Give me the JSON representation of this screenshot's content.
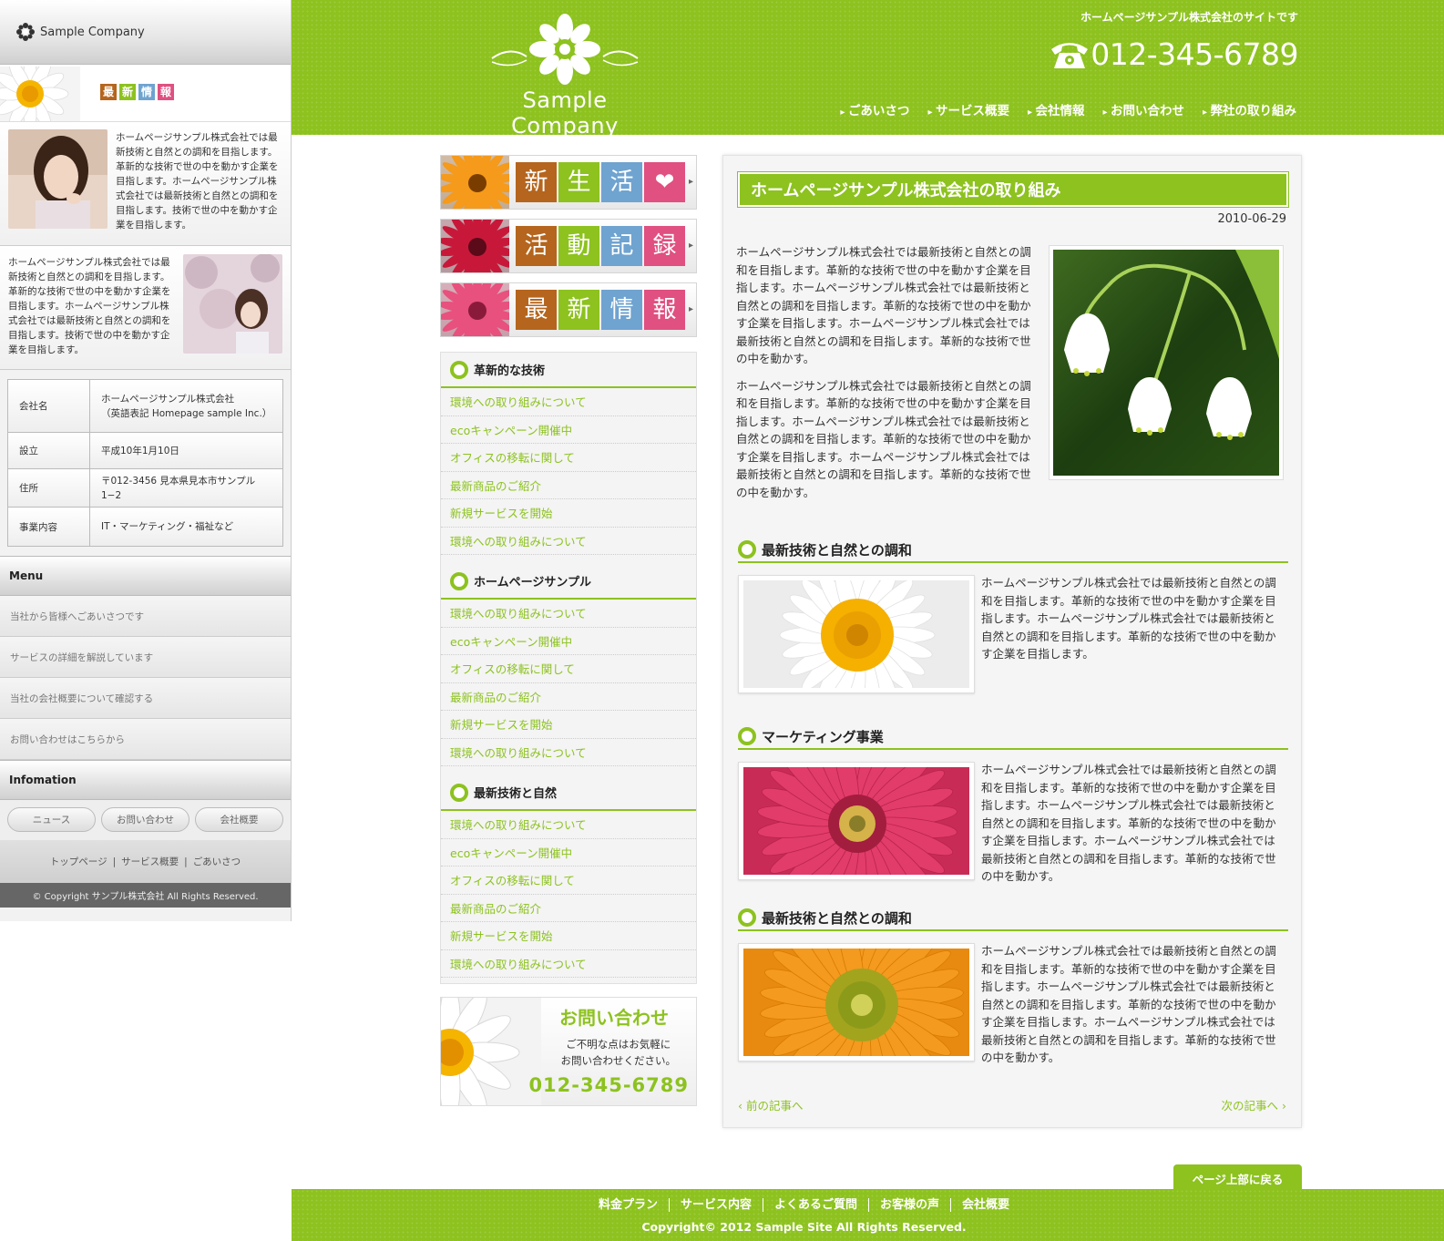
{
  "brand": {
    "sidebar_logo": "Sample Company",
    "header_logo": "Sample Company",
    "tagline": "ホームページサンプル株式会社のサイトです",
    "phone": "012-345-6789",
    "accent": "#8dc21f"
  },
  "header_nav": [
    "ごあいさつ",
    "サービス概要",
    "会社情報",
    "お問い合わせ",
    "弊社の取り組み"
  ],
  "sidebar": {
    "news_tiles": [
      {
        "char": "最",
        "color": "#b5651d"
      },
      {
        "char": "新",
        "color": "#8dc21f"
      },
      {
        "char": "情",
        "color": "#6fa3d0"
      },
      {
        "char": "報",
        "color": "#e05080"
      }
    ],
    "profile1_text": "ホームページサンプル株式会社では最新技術と自然との調和を目指します。革新的な技術で世の中を動かす企業を目指します。ホームページサンプル株式会社では最新技術と自然との調和を目指します。技術で世の中を動かす企業を目指します。",
    "profile2_text": "ホームページサンプル株式会社では最新技術と自然との調和を目指します。革新的な技術で世の中を動かす企業を目指します。ホームページサンプル株式会社では最新技術と自然との調和を目指します。技術で世の中を動かす企業を目指します。",
    "company_table": [
      {
        "key": "会社名",
        "value": "ホームページサンプル株式会社\n（英語表記 Homepage sample Inc.）"
      },
      {
        "key": "設立",
        "value": "平成10年1月10日"
      },
      {
        "key": "住所",
        "value": "〒012-3456 見本県見本市サンプル1−2"
      },
      {
        "key": "事業内容",
        "value": "IT・マーケティング・福祉など"
      }
    ],
    "menu_title": "Menu",
    "menu_items": [
      "当社から皆様へごあいさつです",
      "サービスの詳細を解説しています",
      "当社の会社概要について確認する",
      "お問い合わせはこちらから"
    ],
    "info_title": "Infomation",
    "info_buttons": [
      "ニュース",
      "お問い合わせ",
      "会社概要"
    ],
    "footer_links": [
      "トップページ",
      "|",
      "サービス概要",
      "|",
      "ごあいさつ"
    ],
    "copyright": "© Copyright サンプル株式会社 All Rights Reserved."
  },
  "banners": [
    {
      "flower": "#f59a1a",
      "center": "#7a3d00",
      "tiles": [
        {
          "char": "新",
          "color": "#b5651d"
        },
        {
          "char": "生",
          "color": "#8dc21f"
        },
        {
          "char": "活",
          "color": "#6fa3d0"
        },
        {
          "char": "❤",
          "color": "#e05080"
        }
      ]
    },
    {
      "flower": "#c8183a",
      "center": "#5a0a18",
      "tiles": [
        {
          "char": "活",
          "color": "#b5651d"
        },
        {
          "char": "動",
          "color": "#8dc21f"
        },
        {
          "char": "記",
          "color": "#6fa3d0"
        },
        {
          "char": "録",
          "color": "#e05080"
        }
      ]
    },
    {
      "flower": "#e8507e",
      "center": "#8a1a3a",
      "tiles": [
        {
          "char": "最",
          "color": "#b5651d"
        },
        {
          "char": "新",
          "color": "#8dc21f"
        },
        {
          "char": "情",
          "color": "#6fa3d0"
        },
        {
          "char": "報",
          "color": "#e05080"
        }
      ]
    }
  ],
  "categories": [
    {
      "title": "革新的な技術",
      "items": [
        "環境への取り組みについて",
        "ecoキャンペーン開催中",
        "オフィスの移転に関して",
        "最新商品のご紹介",
        "新規サービスを開始",
        "環境への取り組みについて"
      ]
    },
    {
      "title": "ホームページサンプル",
      "items": [
        "環境への取り組みについて",
        "ecoキャンペーン開催中",
        "オフィスの移転に関して",
        "最新商品のご紹介",
        "新規サービスを開始",
        "環境への取り組みについて"
      ]
    },
    {
      "title": "最新技術と自然",
      "items": [
        "環境への取り組みについて",
        "ecoキャンペーン開催中",
        "オフィスの移転に関して",
        "最新商品のご紹介",
        "新規サービスを開始",
        "環境への取り組みについて"
      ]
    }
  ],
  "contact_box": {
    "title": "お問い合わせ",
    "message": "ご不明な点はお気軽に\nお問い合わせください。",
    "phone": "012-345-6789"
  },
  "article": {
    "title": "ホームページサンプル株式会社の取り組み",
    "date": "2010-06-29",
    "intro": [
      "ホームページサンプル株式会社では最新技術と自然との調和を目指します。革新的な技術で世の中を動かす企業を目指します。ホームページサンプル株式会社では最新技術と自然との調和を目指します。革新的な技術で世の中を動かす企業を目指します。ホームページサンプル株式会社では最新技術と自然との調和を目指します。革新的な技術で世の中を動かす。",
      "ホームページサンプル株式会社では最新技術と自然との調和を目指します。革新的な技術で世の中を動かす企業を目指します。ホームページサンプル株式会社では最新技術と自然との調和を目指します。革新的な技術で世の中を動かす企業を目指します。ホームページサンプル株式会社では最新技術と自然との調和を目指します。革新的な技術で世の中を動かす。"
    ],
    "sections": [
      {
        "heading": "最新技術と自然との調和",
        "flower": "daisy",
        "text": "ホームページサンプル株式会社では最新技術と自然との調和を目指します。革新的な技術で世の中を動かす企業を目指します。ホームページサンプル株式会社では最新技術と自然との調和を目指します。革新的な技術で世の中を動かす企業を目指します。"
      },
      {
        "heading": "マーケティング事業",
        "flower": "pink",
        "text": "ホームページサンプル株式会社では最新技術と自然との調和を目指します。革新的な技術で世の中を動かす企業を目指します。ホームページサンプル株式会社では最新技術と自然との調和を目指します。革新的な技術で世の中を動かす企業を目指します。ホームページサンプル株式会社では最新技術と自然との調和を目指します。革新的な技術で世の中を動かす。"
      },
      {
        "heading": "最新技術と自然との調和",
        "flower": "orange",
        "text": "ホームページサンプル株式会社では最新技術と自然との調和を目指します。革新的な技術で世の中を動かす企業を目指します。ホームページサンプル株式会社では最新技術と自然との調和を目指します。革新的な技術で世の中を動かす企業を目指します。ホームページサンプル株式会社では最新技術と自然との調和を目指します。革新的な技術で世の中を動かす。"
      }
    ],
    "prev": "前の記事へ",
    "next": "次の記事へ"
  },
  "page_top": "ページ上部に戻る",
  "footer": {
    "nav": [
      "料金プラン",
      "サービス内容",
      "よくあるご質問",
      "お客様の声",
      "会社概要"
    ],
    "copyright": "Copyright© 2012 Sample Site All Rights Reserved."
  }
}
